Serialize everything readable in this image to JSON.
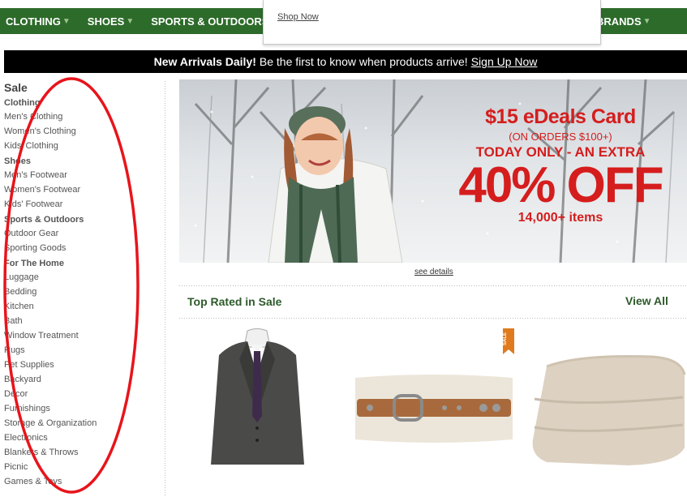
{
  "nav": {
    "items": [
      {
        "label": "CLOTHING"
      },
      {
        "label": "SHOES"
      },
      {
        "label": "SPORTS & OUTDOORS"
      }
    ],
    "brands_label": "BRANDS",
    "arrow": "▼",
    "color": "#2d6b2a"
  },
  "dropdown": {
    "shop_now": "Shop Now"
  },
  "banner": {
    "bold": "New Arrivals Daily!",
    "text": "Be the first to know when products arrive!",
    "link": "Sign Up Now"
  },
  "sidebar": {
    "title": "Sale",
    "sections": [
      {
        "heading": "Clothing",
        "links": [
          "Men's Clothing",
          "Women's Clothing",
          "Kids' Clothing"
        ]
      },
      {
        "heading": "Shoes",
        "links": [
          "Men's Footwear",
          "Women's Footwear",
          "Kids' Footwear"
        ]
      },
      {
        "heading": "Sports & Outdoors",
        "links": [
          "Outdoor Gear",
          "Sporting Goods"
        ]
      },
      {
        "heading": "For The Home",
        "links": [
          "Luggage",
          "Bedding",
          "Kitchen",
          "Bath",
          "Window Treatment",
          "Rugs",
          "Pet Supplies",
          "Backyard",
          "Decor",
          "Furnishings",
          "Storage & Organization",
          "Electronics",
          "Blankets & Throws",
          "Picnic",
          "Games & Toys"
        ]
      }
    ]
  },
  "hero": {
    "line1": "$15 eDeals Card",
    "line2": "(ON ORDERS $100+)",
    "line3": "TODAY ONLY - AN EXTRA",
    "line4": "40% OFF",
    "line5": "14,000+ items",
    "promo_color": "#d51d1d"
  },
  "see_details": "see details",
  "top_rated": {
    "title": "Top Rated in Sale",
    "view_all": "View All"
  },
  "products": {
    "badge": "SALE",
    "items": [
      {
        "icon": "suit-jacket-image"
      },
      {
        "icon": "leather-belt-image"
      },
      {
        "icon": "folded-blanket-image"
      }
    ]
  },
  "annotation_color": "#e8141b"
}
